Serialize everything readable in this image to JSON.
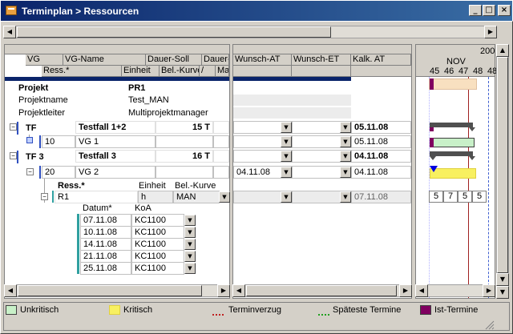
{
  "window": {
    "title": "Terminplan > Ressourcen",
    "minimize": "_",
    "maximize": "□",
    "close": "×"
  },
  "columns_left": {
    "top": [
      "VG",
      "VG-Name",
      "Dauer-Soll",
      "Dauer-"
    ],
    "bottom": [
      "Ress.*",
      "Einheit",
      "Bel.-Kurve",
      "/",
      "Ma"
    ]
  },
  "columns_mid": [
    "Wunsch-AT",
    "Wunsch-ET",
    "Kalk. AT"
  ],
  "gantt_header": {
    "year": "200",
    "month": "NOV",
    "weeks": [
      "45",
      "46",
      "47",
      "48",
      "48"
    ]
  },
  "project": {
    "label": "Projekt",
    "value": "PR1",
    "name_label": "Projektname",
    "name_value": "Test_MAN",
    "lead_label": "Projektleiter",
    "lead_value": "Multiprojektmanager"
  },
  "rows": {
    "tf": {
      "vg": "TF",
      "name": "Testfall 1+2",
      "dauer": "15 T",
      "kalk": "05.11.08"
    },
    "vg10": {
      "vg": "10",
      "name": "VG 1",
      "kalk": "05.11.08"
    },
    "tf3": {
      "vg": "TF 3",
      "name": "Testfall 3",
      "dauer": "16 T",
      "kalk": "04.11.08"
    },
    "vg20": {
      "vg": "20",
      "name": "VG 2",
      "wunsch_at": "04.11.08",
      "kalk": "04.11.08"
    }
  },
  "resources": {
    "header_ress": "Ress.*",
    "header_einheit": "Einheit",
    "header_belkurve": "Bel.-Kurve",
    "r1": {
      "name": "R1",
      "einheit": "h",
      "belkurve": "MAN",
      "kalk": "07.11.08"
    }
  },
  "gantt_values": [
    "5",
    "7",
    "5",
    "5"
  ],
  "koa_table": {
    "headers": [
      "Datum*",
      "KoA"
    ],
    "rows": [
      {
        "datum": "07.11.08",
        "koa": "KC1100"
      },
      {
        "datum": "10.11.08",
        "koa": "KC1100"
      },
      {
        "datum": "14.11.08",
        "koa": "KC1100"
      },
      {
        "datum": "21.11.08",
        "koa": "KC1100"
      },
      {
        "datum": "25.11.08",
        "koa": "KC1100"
      }
    ]
  },
  "legend": {
    "unkritisch": "Unkritisch",
    "kritisch": "Kritisch",
    "terminverzug": "Terminverzug",
    "spaeteste": "Späteste Termine",
    "ist": "Ist-Termine"
  },
  "colors": {
    "unkritisch": "#c8f0c8",
    "kritisch": "#f8f060",
    "ist": "#800060",
    "today_line": "#a02020",
    "title_bar": "#0a246a"
  }
}
